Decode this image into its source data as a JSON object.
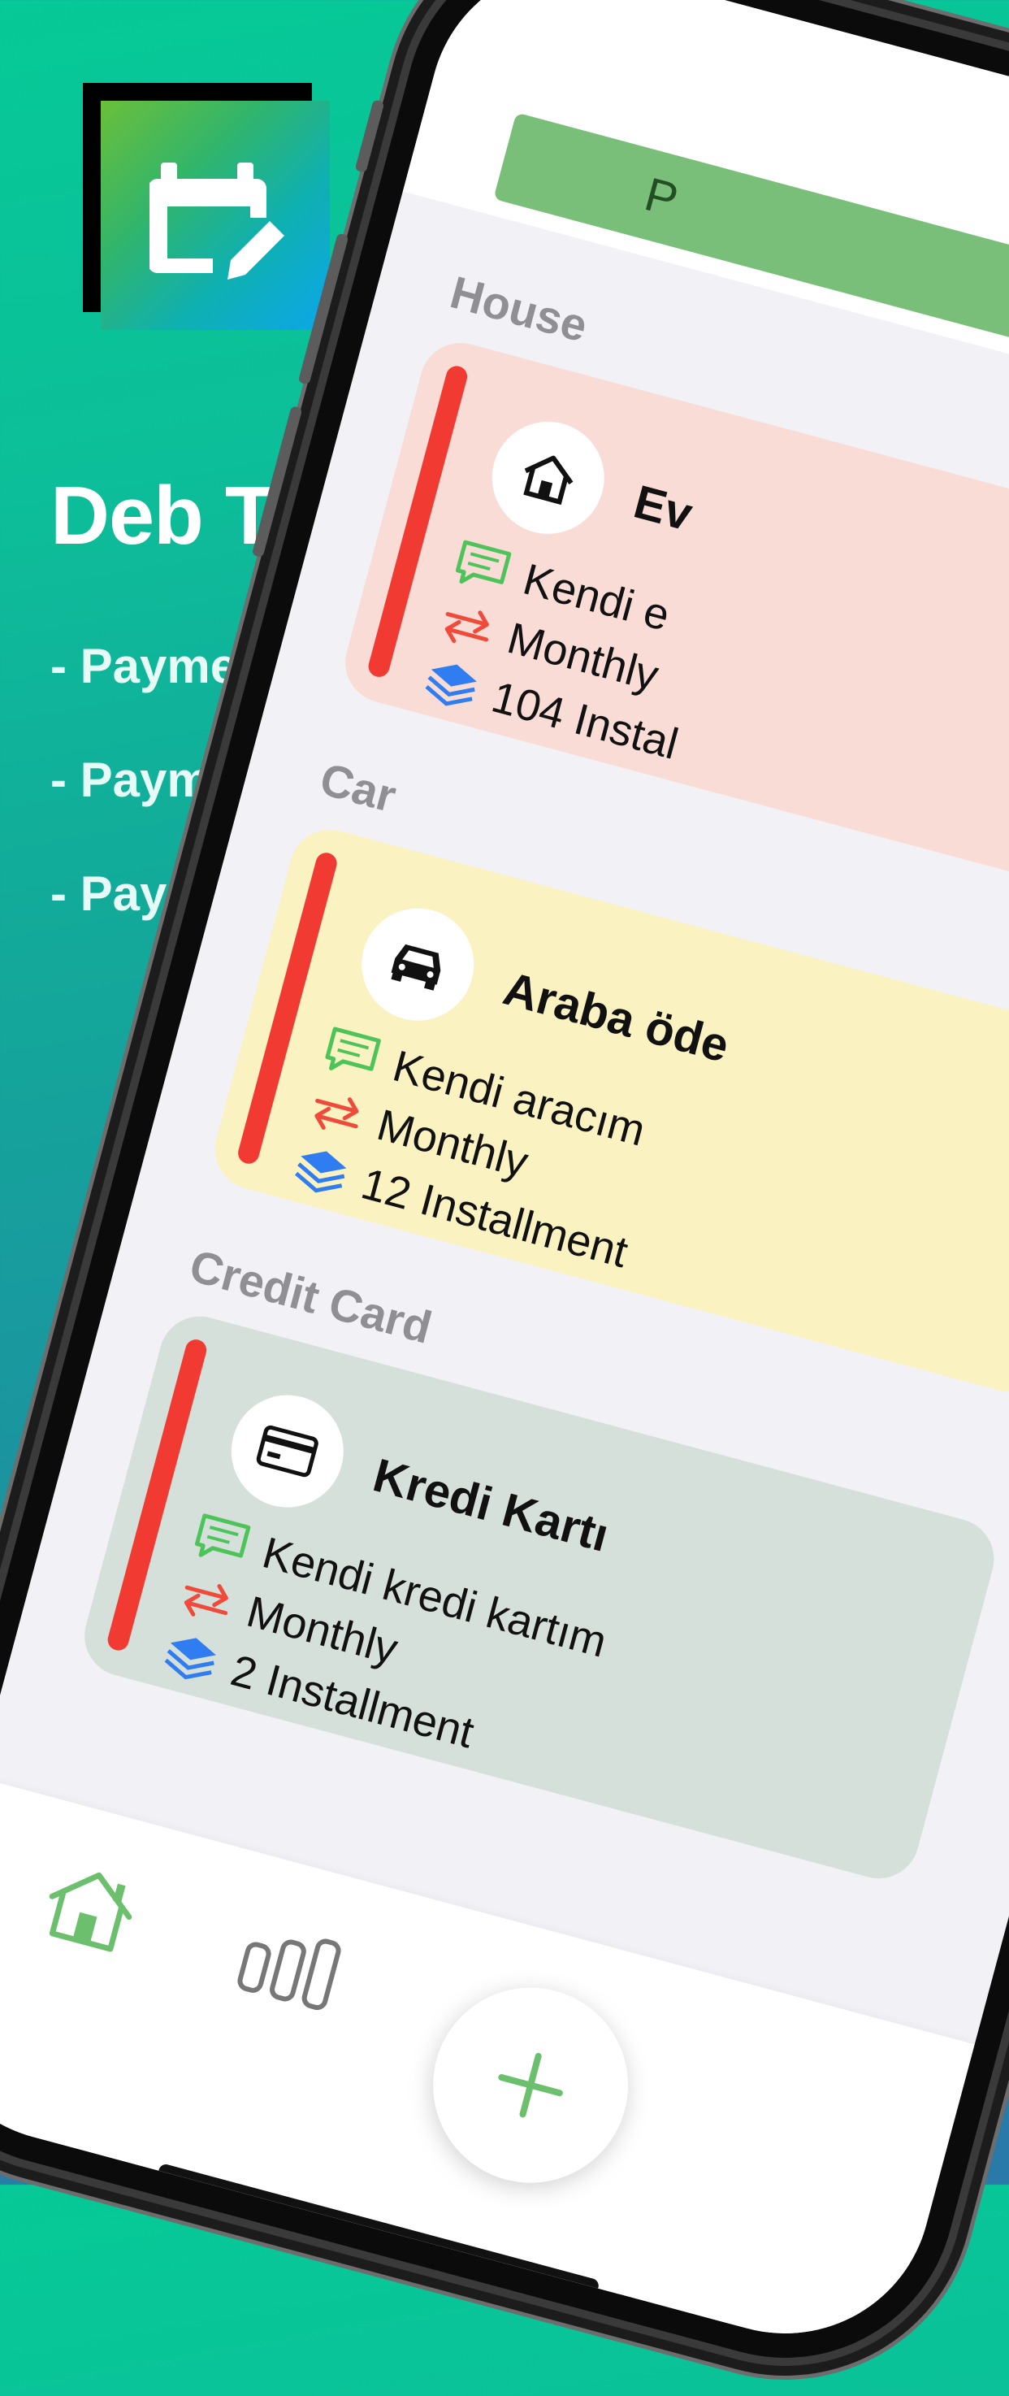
{
  "app": {
    "title": "Deb Tracking",
    "features": [
      "- Payment Tracking",
      "- Payment Reminder",
      "- Payment Summary"
    ]
  },
  "screen": {
    "header_pill_text": "P",
    "sections": [
      {
        "label": "House",
        "card": {
          "title": "Ev",
          "description": "Kendi e",
          "frequency": "Monthly",
          "installments": "104 Instal",
          "icon": "house-icon",
          "color": "#fadcd6"
        }
      },
      {
        "label": "Car",
        "card": {
          "title": "Araba öde",
          "description": "Kendi aracım",
          "frequency": "Monthly",
          "installments": "12 Installment",
          "icon": "car-icon",
          "color": "#fbf2c2"
        }
      },
      {
        "label": "Credit Card",
        "card": {
          "title": "Kredi Kartı",
          "description": "Kendi kredi kartım",
          "frequency": "Monthly",
          "installments": "2 Installment",
          "icon": "credit-card-icon",
          "color": "#d6e0da"
        }
      }
    ],
    "tabs": [
      {
        "name": "home",
        "icon": "home-icon"
      },
      {
        "name": "stats",
        "icon": "bar-chart-icon"
      }
    ],
    "fab_icon": "plus-icon"
  },
  "colors": {
    "accent_green": "#6cbf6c",
    "indicator_red": "#f03a32",
    "repeat_icon": "#f04a3a",
    "comment_icon": "#4cc45a",
    "layers_icon": "#2f7df0"
  }
}
